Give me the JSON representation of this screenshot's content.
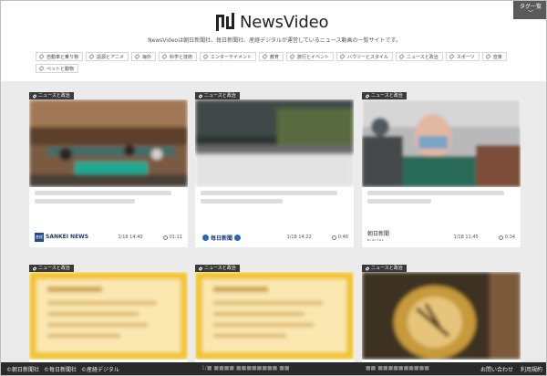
{
  "header": {
    "logo_text": "NewsVideo",
    "tagline": "NewsVideoは朝日新聞社、毎日新聞社、産経デジタルが運営しているニュース動画の一覧サイトです。",
    "tag_button_label": "タグ一覧",
    "tag_button_chevron": "﹀"
  },
  "categories": [
    "自動車と乗り物",
    "語源とアニメ",
    "海外",
    "科学と技術",
    "エンターテイメント",
    "教育",
    "旅行とイベント",
    "ハウツーとスタイル",
    "ニュースと政治",
    "スポーツ",
    "音楽",
    "ペットと動物"
  ],
  "cards": [
    {
      "badge": "ニュースと政治",
      "publisher": "SANKEI NEWS",
      "publisher_mark": "産経",
      "date": "1/18 14:40",
      "duration": "01:11"
    },
    {
      "badge": "ニュースと政治",
      "publisher": "毎日新聞",
      "date": "1/18 14:22",
      "duration": "0:46"
    },
    {
      "badge": "ニュースと政治",
      "publisher": "朝日新聞",
      "publisher_sub": "DIGITAL",
      "date": "1/18 11:45",
      "duration": "0:34"
    },
    {
      "badge": "ニュースと政治"
    },
    {
      "badge": "ニュースと政治"
    },
    {
      "badge": "ニュースと政治"
    }
  ],
  "footer": {
    "links_left": [
      "©朝日新聞社",
      "©毎日新聞社",
      "©産経デジタル"
    ],
    "links_right": [
      "お問い合わせ",
      "利用規約"
    ],
    "ghost_text_1": "1/■ ■■■■ ■■■■■■■■ ■■",
    "ghost_text_2": "■■ ■■■■■■■■■■"
  },
  "colors": {
    "background": "#ebebeb",
    "header_bg": "#ffffff",
    "badge_bg": "#3a3a3a",
    "footer_bg": "#2a2a2a",
    "sankei_blue": "#1f4a8c",
    "mainichi_blue": "#2a67b4"
  }
}
